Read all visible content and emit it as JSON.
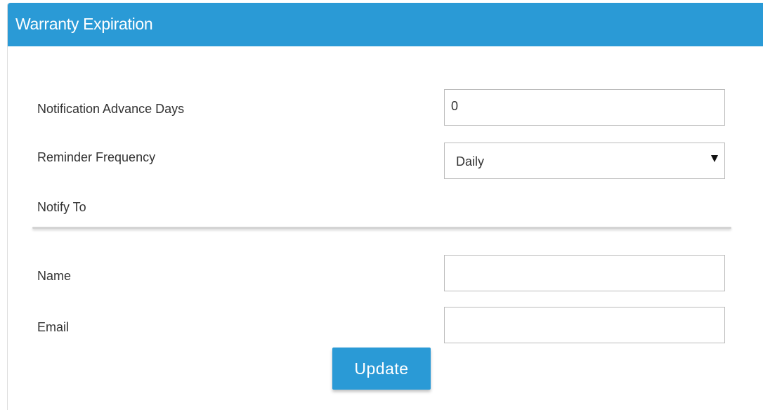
{
  "panel": {
    "title": "Warranty Expiration"
  },
  "form": {
    "notification_advance_days": {
      "label": "Notification Advance Days",
      "value": "0"
    },
    "reminder_frequency": {
      "label": "Reminder Frequency",
      "selected": "Daily"
    },
    "notify_to": {
      "label": "Notify To"
    },
    "name": {
      "label": "Name",
      "value": ""
    },
    "email": {
      "label": "Email",
      "value": ""
    },
    "update_label": "Update"
  },
  "icons": {
    "dropdown": "caret-down-icon"
  },
  "colors": {
    "accent": "#2a9ad6",
    "header_text": "#ffffff",
    "label_text": "#333333",
    "input_border": "#bbbbbb"
  }
}
